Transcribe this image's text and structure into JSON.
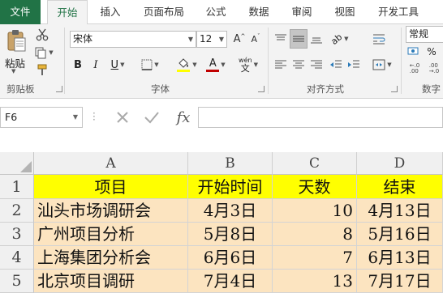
{
  "menu": {
    "tabs": [
      {
        "label": "文件"
      },
      {
        "label": "开始"
      },
      {
        "label": "插入"
      },
      {
        "label": "页面布局"
      },
      {
        "label": "公式"
      },
      {
        "label": "数据"
      },
      {
        "label": "审阅"
      },
      {
        "label": "视图"
      },
      {
        "label": "开发工具"
      }
    ],
    "active_tab": "开始",
    "accent_color": "#217346"
  },
  "ribbon": {
    "clipboard": {
      "paste_label": "粘贴",
      "group_label": "剪贴板"
    },
    "font": {
      "font_name": "宋体",
      "font_size": "12",
      "grow_label": "A",
      "shrink_label": "A",
      "bold": "B",
      "italic": "I",
      "underline": "U",
      "font_color_letter": "A",
      "phonetic_label": "wén",
      "group_label": "字体",
      "font_color": "#c00000",
      "fill_color": "#ffff00"
    },
    "alignment": {
      "group_label": "对齐方式"
    },
    "number": {
      "format": "常规",
      "group_label": "数字"
    }
  },
  "formula_bar": {
    "name_box": "F6",
    "fx_label": "fx",
    "formula": ""
  },
  "sheet": {
    "columns": [
      "A",
      "B",
      "C",
      "D"
    ],
    "rows": [
      "1",
      "2",
      "3",
      "4",
      "5"
    ],
    "header": [
      "项目",
      "开始时间",
      "天数",
      "结束"
    ],
    "data": [
      [
        "汕头市场调研会",
        "4月3日",
        "10",
        "4月13日"
      ],
      [
        "广州项目分析",
        "5月8日",
        "8",
        "5月16日"
      ],
      [
        "上海集团分析会",
        "6月6日",
        "7",
        "6月13日"
      ],
      [
        "北京项目调研",
        "7月4日",
        "13",
        "7月17日"
      ]
    ],
    "header_fill": "#ffff00",
    "body_fill": "#fce4c0"
  }
}
